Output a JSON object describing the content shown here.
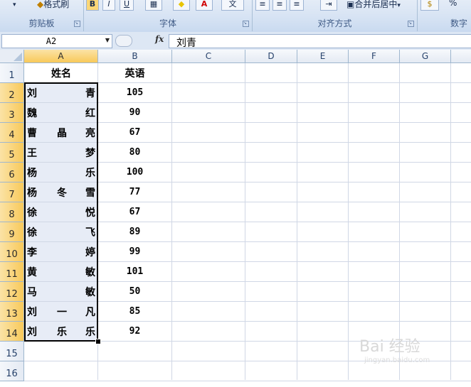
{
  "ribbon": {
    "groups": [
      {
        "label": "剪贴板"
      },
      {
        "label": "字体"
      },
      {
        "label": "对齐方式"
      },
      {
        "label": "数字"
      }
    ],
    "clipboard_partial": "格式刷",
    "merge_partial": "合并后居中",
    "bold": "B",
    "italic": "I",
    "underline": "U",
    "font_color_glyph": "A",
    "percent_glyph": "%"
  },
  "formula_bar": {
    "name_box": "A2",
    "fx_label": "fx",
    "formula": "刘青"
  },
  "grid": {
    "columns": [
      "A",
      "B",
      "C",
      "D",
      "E",
      "F",
      "G"
    ],
    "selected_column": "A",
    "rows": [
      "1",
      "2",
      "3",
      "4",
      "5",
      "6",
      "7",
      "8",
      "9",
      "10",
      "11",
      "12",
      "13",
      "14",
      "15",
      "16"
    ],
    "header": {
      "name": "姓名",
      "score": "英语"
    },
    "students": [
      {
        "chars": [
          "刘",
          "",
          "青"
        ],
        "score": "105"
      },
      {
        "chars": [
          "魏",
          "",
          "红"
        ],
        "score": "90"
      },
      {
        "chars": [
          "曹",
          "晶",
          "亮"
        ],
        "score": "67"
      },
      {
        "chars": [
          "王",
          "",
          "梦"
        ],
        "score": "80"
      },
      {
        "chars": [
          "杨",
          "",
          "乐"
        ],
        "score": "100"
      },
      {
        "chars": [
          "杨",
          "冬",
          "雪"
        ],
        "score": "77"
      },
      {
        "chars": [
          "徐",
          "",
          "悦"
        ],
        "score": "67"
      },
      {
        "chars": [
          "徐",
          "",
          "飞"
        ],
        "score": "89"
      },
      {
        "chars": [
          "李",
          "",
          "婷"
        ],
        "score": "99"
      },
      {
        "chars": [
          "黄",
          "",
          "敏"
        ],
        "score": "101"
      },
      {
        "chars": [
          "马",
          "",
          "敏"
        ],
        "score": "50"
      },
      {
        "chars": [
          "刘",
          "一",
          "凡"
        ],
        "score": "85"
      },
      {
        "chars": [
          "刘",
          "乐",
          "乐"
        ],
        "score": "92"
      }
    ]
  },
  "watermark": {
    "text": "Bai 经验",
    "sub": "jingyan.baidu.com"
  },
  "colors": {
    "selection_fill": "#e7ecf6",
    "header_selected": "#f8c95a",
    "grid_line": "#d0d7e5"
  }
}
